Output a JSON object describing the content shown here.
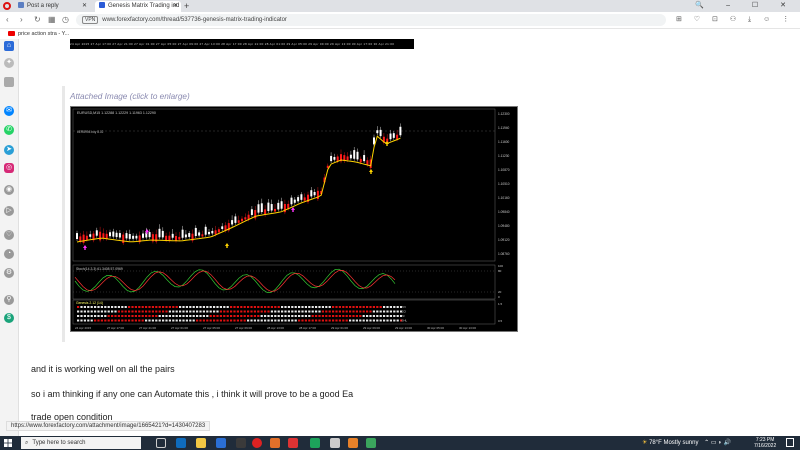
{
  "browser": {
    "tabs": [
      {
        "label": "Post a reply",
        "active": false,
        "icon": "forum-icon"
      },
      {
        "label": "Genesis Matrix Trading ind",
        "active": true,
        "icon": "forexfactory-icon"
      }
    ],
    "new_tab": "+",
    "url": "www.forexfactory.com/thread/537736-genesis-matrix-trading-indicator",
    "vpn_badge": "VPN",
    "bookmark": "price action stra - Y..."
  },
  "chart_strip": {
    "time_labels": [
      "24 Apr 2015",
      "27 Apr 17:00",
      "27 Apr 21:00",
      "27 Apr 01:00",
      "27 Apr 05:00",
      "27 Apr 09:00",
      "27 Apr 13:00",
      "28 Apr 17:00",
      "28 Apr 21:00",
      "28 Apr 01:00",
      "29 Apr 05:00",
      "29 Apr 09:00",
      "29 Apr 13:00",
      "30 Apr 17:00",
      "30 Apr 21:00"
    ]
  },
  "attachment": {
    "title": "Attached Image (click to enlarge)",
    "chart_header": "EURUSD,M15  1.12288 1.12229 1.11963 1.12290",
    "mini_label": "#ER8994.buy 8.02",
    "price_labels": [
      "1.12300",
      "1.11940",
      "1.11600",
      "1.11230",
      "1.10870",
      "1.10510",
      "1.10160",
      "1.09840",
      "1.09480",
      "1.09120",
      "1.08760"
    ],
    "stoch_label": "Stoch(14,3,3) 61.3408 57.0969",
    "stoch_scale": [
      "100",
      "80",
      "20",
      "0"
    ],
    "matrix_label": "Genesis 2.12 (14)",
    "matrix_scale": [
      "1.5",
      "",
      "",
      "0.5"
    ],
    "matrix_rows": [
      "TVI",
      "CCI",
      "T3",
      "GHL"
    ],
    "bottom_times": [
      "24 Apr 2015",
      "27 Apr 17:00",
      "27 Apr 21:00",
      "27 Apr 01:00",
      "27 Apr 05:00",
      "27 Apr 09:00",
      "28 Apr 13:00",
      "28 Apr 17:00",
      "29 Apr 01:00",
      "29 Apr 09:00",
      "29 Apr 13:00",
      "30 Apr 05:00",
      "30 Apr 13:00"
    ]
  },
  "post": {
    "line1": "and it is working well on all the pairs",
    "line2": "so i am thinking if any one can Automate this , i think it will prove to be a good Ea",
    "line3": "trade open condition"
  },
  "status_url": "https://www.forexfactory.com/attachment/image/1665421?d=1430407283",
  "taskbar": {
    "search_placeholder": "Type here to search",
    "weather": "78°F  Mostly sunny",
    "time": "7:23 PM",
    "date": "7/16/2022"
  },
  "colors": {
    "bull": "#ffffff",
    "bear": "#ff1a1a",
    "ma": "#ffd400",
    "signal": "#ff33ff",
    "stoch_main": "#33cc33"
  }
}
